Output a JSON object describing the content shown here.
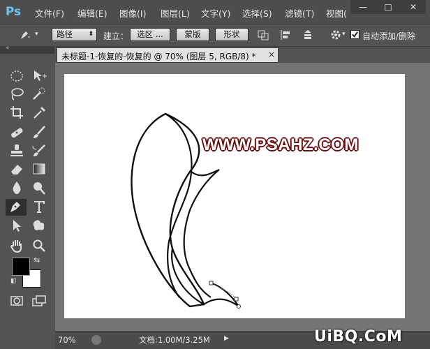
{
  "app": {
    "logo": "Ps",
    "menu": [
      "文件(F)",
      "编辑(E)",
      "图像(I)",
      "图层(L)",
      "文字(Y)",
      "选择(S)",
      "滤镜(T)",
      "视图("
    ],
    "window_controls": [
      "—",
      "□",
      "✕"
    ]
  },
  "options": {
    "mode_select": "路径",
    "create_label": "建立：",
    "selection_btn": "选区 ...",
    "mask_btn": "蒙版",
    "shape_btn": "形状",
    "auto_add_delete": "自动添加/删除"
  },
  "tools_icons": [
    "marquee-icon",
    "move-icon",
    "lasso-icon",
    "quick-select-icon",
    "crop-icon",
    "eyedropper-icon",
    "healing-icon",
    "brush-icon",
    "stamp-icon",
    "history-brush-icon",
    "eraser-icon",
    "gradient-icon",
    "blur-icon",
    "dodge-icon",
    "pen-icon",
    "type-icon",
    "path-select-icon",
    "shape-icon",
    "hand-icon",
    "zoom-icon"
  ],
  "document": {
    "tab_title": "未标题-1-恢复的-恢复的 @ 70% (图层 5, RGB/8) *",
    "close": "×"
  },
  "canvas": {
    "watermark_text": "WWW.PSAHZ.COM"
  },
  "status": {
    "zoom": "70%",
    "doc_info": "文档:1.00M/3.25M"
  },
  "site_watermark": "UiBQ.CoM",
  "colors": {
    "foreground": "#000000",
    "background": "#ffffff",
    "accent": "#6ec2f2"
  }
}
